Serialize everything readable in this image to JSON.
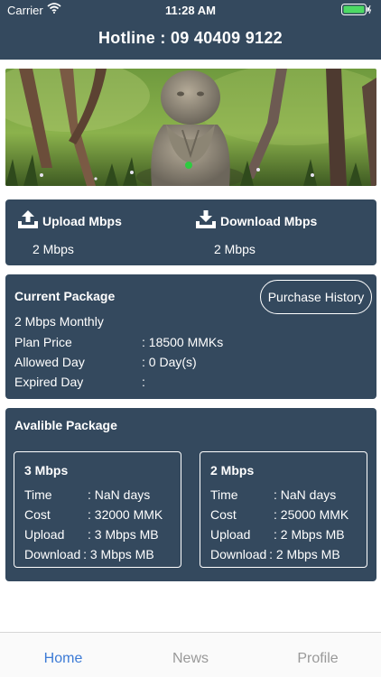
{
  "status_bar": {
    "carrier": "Carrier",
    "time": "11:28 AM"
  },
  "header": {
    "hotline": "Hotline : 09 40409 9122"
  },
  "banner": {
    "image": "garden-statue-photo",
    "active_slide": 1
  },
  "speed": {
    "upload_label": "Upload Mbps",
    "upload_value": "2 Mbps",
    "download_label": "Download Mbps",
    "download_value": "2 Mbps"
  },
  "current_package": {
    "title": "Current Package",
    "purchase_history_label": "Purchase History",
    "plan_name": "2 Mbps Monthly",
    "rows": [
      {
        "label": "Plan Price",
        "value": ": 18500 MMKs"
      },
      {
        "label": "Allowed Day",
        "value": ": 0 Day(s)"
      },
      {
        "label": "Expired Day",
        "value": ":"
      }
    ]
  },
  "available": {
    "title": "Avalible Package",
    "packages": [
      {
        "name": "3 Mbps",
        "rows": [
          {
            "label": "Time",
            "value": ": NaN days"
          },
          {
            "label": "Cost",
            "value": ": 32000 MMK"
          },
          {
            "label": "Upload",
            "value": ": 3 Mbps MB"
          },
          {
            "label": "Download",
            "value": ": 3 Mbps MB"
          }
        ]
      },
      {
        "name": "2 Mbps",
        "rows": [
          {
            "label": "Time",
            "value": ": NaN days"
          },
          {
            "label": "Cost",
            "value": ": 25000 MMK"
          },
          {
            "label": "Upload",
            "value": ": 2 Mbps MB"
          },
          {
            "label": "Download",
            "value": ": 2 Mbps MB"
          }
        ]
      }
    ]
  },
  "tabs": [
    {
      "label": "Home",
      "active": true
    },
    {
      "label": "News",
      "active": false
    },
    {
      "label": "Profile",
      "active": false
    }
  ],
  "colors": {
    "card": "#34495e",
    "accent": "#3d7bd6",
    "indicator": "#2ecc40"
  }
}
